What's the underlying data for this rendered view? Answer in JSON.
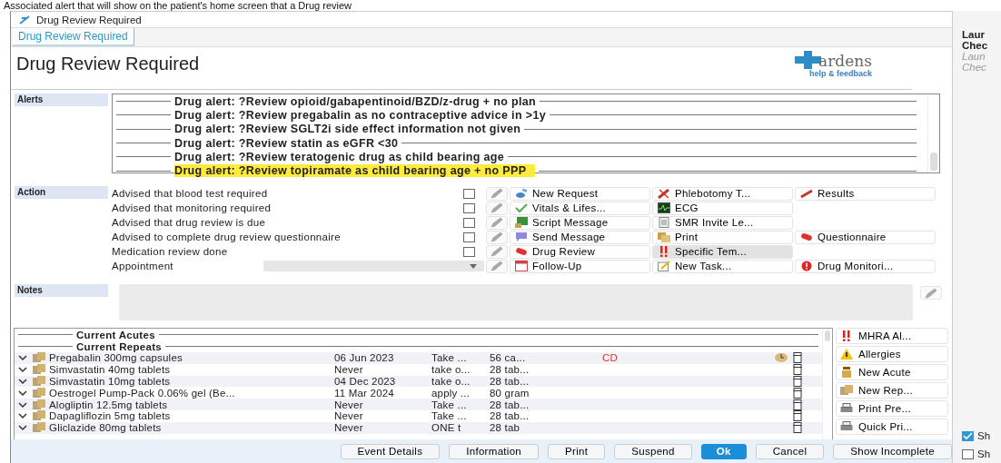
{
  "background_banner": "Associated alert that will show on the patient's home screen that a Drug review",
  "window": {
    "title": "Drug Review Required"
  },
  "tabs": [
    {
      "label": "Drug Review Required",
      "selected": true
    }
  ],
  "heading": "Drug Review Required",
  "logo": {
    "name": "ardens",
    "link": "help & feedback"
  },
  "alerts": {
    "label": "Alerts",
    "items": [
      {
        "text": "Drug alert: ?Review opioid/gabapentinoid/BZD/z-drug + no plan",
        "highlighted": false
      },
      {
        "text": "Drug alert: ?Review pregabalin as no contraceptive advice in >1y",
        "highlighted": false
      },
      {
        "text": "Drug alert: ?Review SGLT2i side effect information not given",
        "highlighted": false
      },
      {
        "text": "Drug alert: ?Review statin as eGFR <30",
        "highlighted": false
      },
      {
        "text": "Drug alert: ?Review teratogenic drug as child bearing age",
        "highlighted": false
      },
      {
        "text": "Drug alert: ?Review topiramate as child bearing age + no PPP",
        "highlighted": true
      }
    ]
  },
  "action": {
    "label": "Action",
    "rows": [
      {
        "label": "Advised that blood test required",
        "kind": "checkbox",
        "checked": false,
        "button_1": {
          "label": "New Request",
          "selected": false
        },
        "button_2": {
          "label": "Phlebotomy T...",
          "selected": false
        },
        "button_3": {
          "label": "Results",
          "selected": false
        }
      },
      {
        "label": "Advised that monitoring required",
        "kind": "checkbox",
        "checked": false,
        "button_1": {
          "label": "Vitals & Lifes...",
          "selected": false
        },
        "button_2": {
          "label": "ECG",
          "selected": false
        }
      },
      {
        "label": "Advised that drug review is due",
        "kind": "checkbox",
        "checked": false,
        "button_1": {
          "label": "Script Message",
          "selected": false
        },
        "button_2": {
          "label": "SMR Invite Le...",
          "selected": false
        }
      },
      {
        "label": "Advised to complete drug review questionnaire",
        "kind": "checkbox",
        "checked": false,
        "button_1": {
          "label": "Send Message",
          "selected": false
        },
        "button_2": {
          "label": "Print",
          "selected": false
        },
        "button_3": {
          "label": "Questionnaire",
          "selected": false
        }
      },
      {
        "label": "Medication review done",
        "kind": "checkbox",
        "checked": false,
        "button_1": {
          "label": "Drug Review",
          "selected": false
        },
        "button_2": {
          "label": "Specific Tem...",
          "selected": true
        }
      },
      {
        "label": "Appointment",
        "kind": "dropdown",
        "button_1": {
          "label": "Follow-Up",
          "selected": false
        },
        "button_2": {
          "label": "New Task...",
          "selected": false
        },
        "button_3": {
          "label": "Drug Monitori...",
          "selected": false
        }
      }
    ]
  },
  "notes": {
    "label": "Notes"
  },
  "medications": {
    "groups": [
      "Current Acutes",
      "Current Repeats"
    ],
    "rows": [
      {
        "name": "Pregabalin 300mg capsules",
        "last_issued": "06 Jun 2023",
        "dosage": "Take ...",
        "quantity": "56 ca...",
        "flag": "CD",
        "timer": true
      },
      {
        "name": "Simvastatin 40mg tablets",
        "last_issued": "Never",
        "dosage": "take o...",
        "quantity": "28 tab...",
        "timer": false
      },
      {
        "name": "Simvastatin 10mg tablets",
        "last_issued": "04 Dec 2023",
        "dosage": "take o...",
        "quantity": "28 tab...",
        "timer": false
      },
      {
        "name": "Oestrogel Pump-Pack 0.06% gel (Be...",
        "last_issued": "11 Mar 2024",
        "dosage": "apply ...",
        "quantity": "80 gram",
        "timer": false
      },
      {
        "name": "Alogliptin 12.5mg tablets",
        "last_issued": "Never",
        "dosage": "Take ...",
        "quantity": "28 tab...",
        "timer": false
      },
      {
        "name": "Dapagliflozin 5mg tablets",
        "last_issued": "Never",
        "dosage": "Take ...",
        "quantity": "28 tab...",
        "timer": false
      },
      {
        "name": "Gliclazide 80mg tablets",
        "last_issued": "Never",
        "dosage": "ONE t",
        "quantity": "28 tab",
        "timer": false
      }
    ]
  },
  "side_buttons": [
    "MHRA Al...",
    "Allergies",
    "New Acute",
    "New Rep...",
    "Print Pre...",
    "Quick Pri..."
  ],
  "footer_buttons": [
    {
      "label": "Event Details",
      "primary": false
    },
    {
      "label": "Information",
      "primary": false
    },
    {
      "label": "Print",
      "primary": false
    },
    {
      "label": "Suspend",
      "primary": false
    },
    {
      "label": "Ok",
      "primary": true
    },
    {
      "label": "Cancel",
      "primary": false
    },
    {
      "label": "Show Incomplete",
      "primary": false
    }
  ],
  "right_panel": {
    "title_lines": [
      "Laur",
      "Chec"
    ],
    "subtitle_lines": [
      "Laun",
      "Chec"
    ],
    "checkboxes": [
      {
        "label": "Sh",
        "checked": true
      },
      {
        "label": "Sh",
        "checked": false
      }
    ]
  }
}
